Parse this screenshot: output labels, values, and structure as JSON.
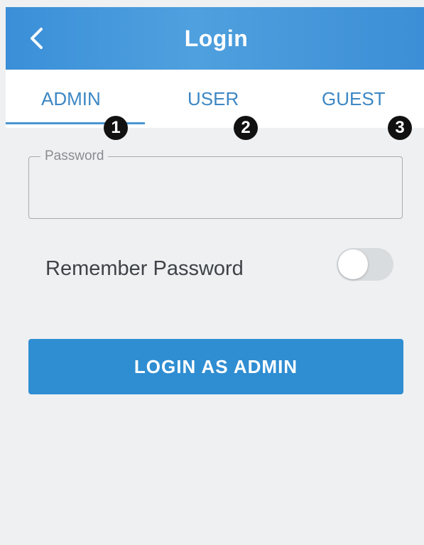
{
  "header": {
    "title": "Login",
    "back_icon": "chevron-left-icon"
  },
  "tabs": [
    {
      "label": "ADMIN",
      "marker": "1",
      "active": true
    },
    {
      "label": "USER",
      "marker": "2",
      "active": false
    },
    {
      "label": "GUEST",
      "marker": "3",
      "active": false
    }
  ],
  "password": {
    "label": "Password",
    "value": ""
  },
  "remember": {
    "label": "Remember Password",
    "enabled": false
  },
  "login_button": {
    "label": "LOGIN AS ADMIN"
  },
  "colors": {
    "header": "#3a8fd8",
    "accent": "#3d87c4",
    "button": "#2f8dd2",
    "background": "#eef0f2"
  }
}
